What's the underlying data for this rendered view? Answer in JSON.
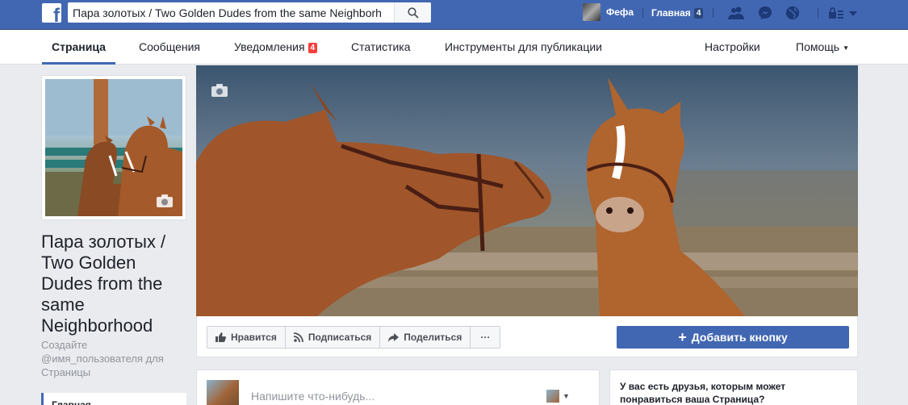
{
  "topbar": {
    "logo": "f",
    "search_value": "Пара золотых / Two Golden Dudes from the same Neighborh",
    "user_name": "Фефа",
    "home_label": "Главная",
    "home_count": "4",
    "icons": [
      "friends-icon",
      "messenger-icon",
      "globe-icon",
      "lock-icon",
      "dropdown-icon"
    ]
  },
  "pagenav": {
    "tabs": [
      {
        "label": "Страница",
        "active": true
      },
      {
        "label": "Сообщения"
      },
      {
        "label": "Уведомления",
        "badge": "4"
      },
      {
        "label": "Статистика"
      },
      {
        "label": "Инструменты для публикации"
      }
    ],
    "settings_label": "Настройки",
    "help_label": "Помощь"
  },
  "page": {
    "name": "Пара золотых / Two Golden Dudes from the same Neighborhood",
    "username_cta": "Создайте @имя_пользователя для Страницы",
    "home_tab": "Главная"
  },
  "actions": {
    "like": "Нравится",
    "follow": "Подписаться",
    "share": "Поделиться",
    "more": "···",
    "add_button": "Добавить кнопку"
  },
  "composer": {
    "placeholder": "Напишите что-нибудь..."
  },
  "suggestion": {
    "text": "У вас есть друзья, которым может понравиться ваша Страница?"
  },
  "colors": {
    "brand_blue": "#4267b2",
    "badge_red": "#fa3e3e",
    "background": "#e9ebee"
  }
}
